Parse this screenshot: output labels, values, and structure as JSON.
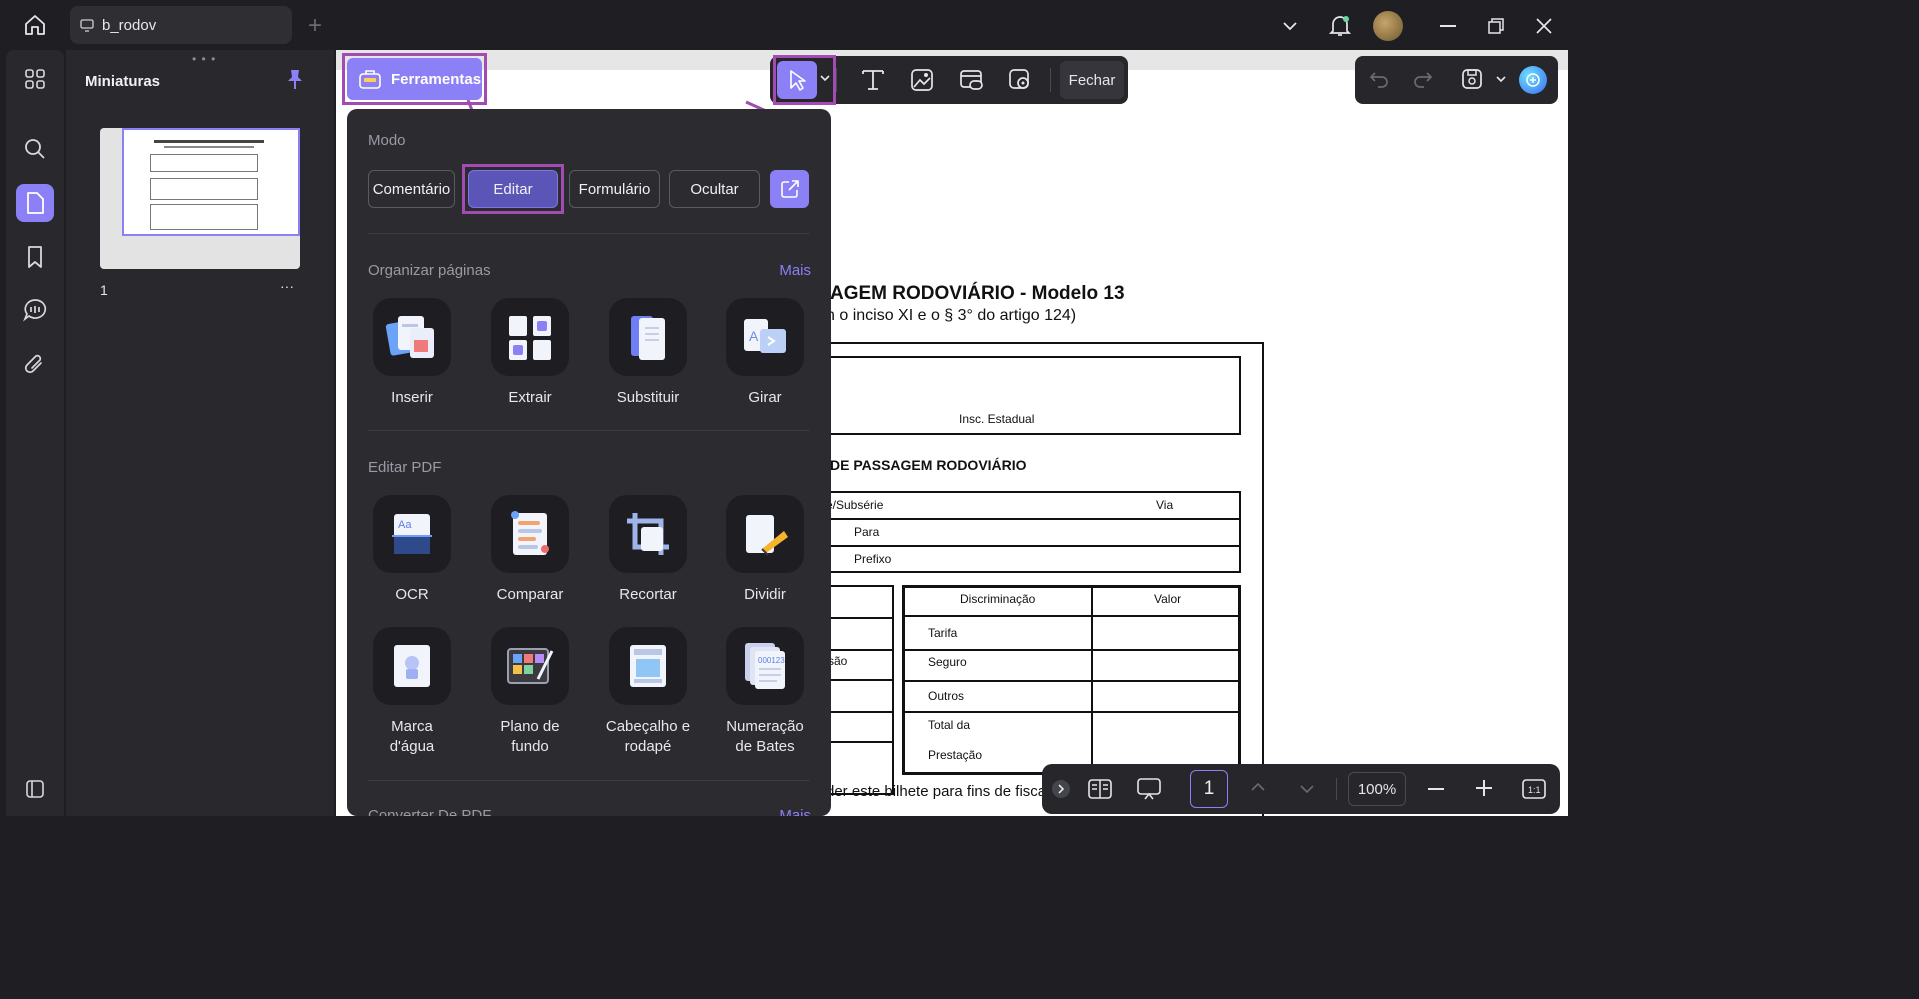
{
  "top": {
    "tab_title": "b_rodov",
    "add_tab": "+"
  },
  "thumbnails": {
    "title": "Miniaturas",
    "page_number": "1",
    "more": "···"
  },
  "toolbar": {
    "tools_label": "Ferramentas",
    "close_label": "Fechar"
  },
  "panel": {
    "mode_title": "Modo",
    "modes": [
      "Comentário",
      "Editar",
      "Formulário",
      "Ocultar"
    ],
    "organize_title": "Organizar páginas",
    "more_label": "Mais",
    "organize_tools": [
      "Inserir",
      "Extrair",
      "Substituir",
      "Girar"
    ],
    "edit_title": "Editar PDF",
    "edit_tools_row1": [
      "OCR",
      "Comparar",
      "Recortar",
      "Dividir"
    ],
    "edit_tools_row2": [
      {
        "l1": "Marca",
        "l2": "d'água"
      },
      {
        "l1": "Plano de",
        "l2": "fundo"
      },
      {
        "l1": "Cabeçalho e",
        "l2": "rodapé"
      },
      {
        "l1": "Numeração",
        "l2": "de Bates"
      }
    ],
    "convert_title": "Converter De PDF",
    "convert_more": "Mais"
  },
  "document": {
    "heading": "AGEM RODOVIÁRIO -  Modelo 13",
    "subheading": "n o inciso XI e o § 3° do artigo 124)",
    "insc": "Insc. Estadual",
    "section": "DE PASSAGEM RODOVIÁRIO",
    "serie": "e/Subsérie",
    "via": "Via",
    "para": "Para",
    "prefixo": "Prefixo",
    "sao": "são",
    "disc": "Discriminação",
    "valor": "Valor",
    "rows": [
      "Tarifa",
      "Seguro",
      "Outros",
      "Total da",
      "Prestação"
    ],
    "footer": "der este bilhete para fins de fisca"
  },
  "bottom": {
    "page": "1",
    "zoom": "100%"
  },
  "colors": {
    "accent": "#8b80f5",
    "highlight": "#a24bb3"
  }
}
